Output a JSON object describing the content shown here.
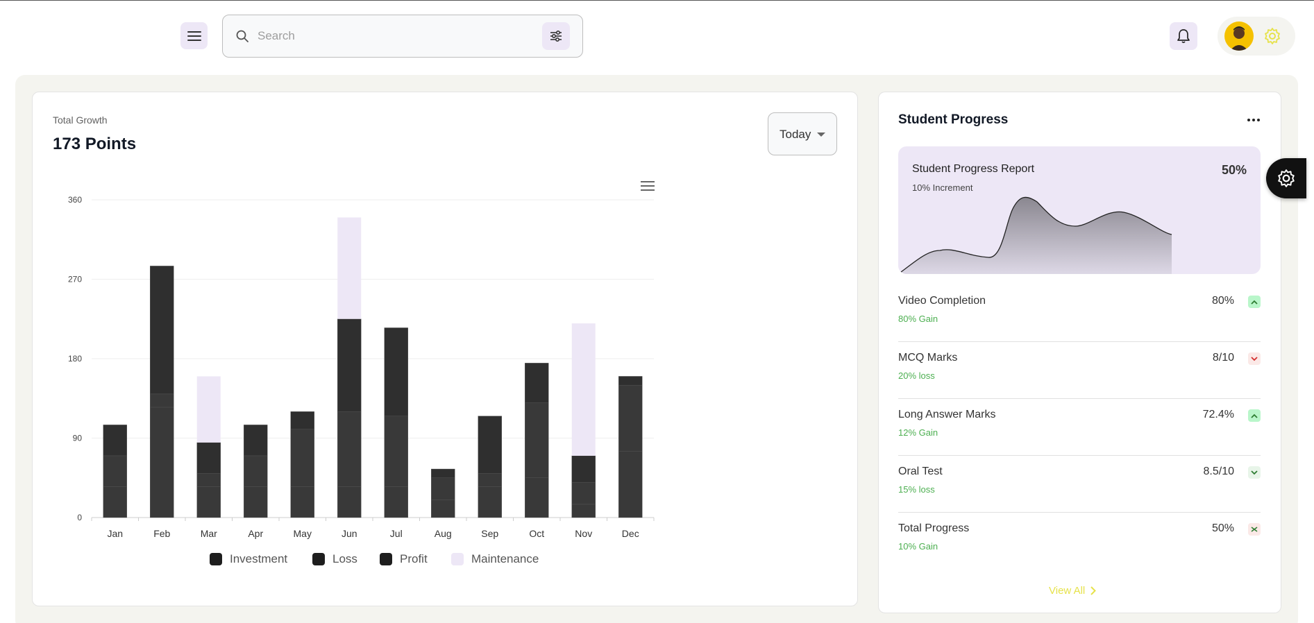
{
  "header": {
    "search_placeholder": "Search"
  },
  "growth": {
    "subtitle": "Total Growth",
    "title": "173 Points",
    "period_select": "Today"
  },
  "chart_data": {
    "type": "bar",
    "stacked": true,
    "categories": [
      "Jan",
      "Feb",
      "Mar",
      "Apr",
      "May",
      "Jun",
      "Jul",
      "Aug",
      "Sep",
      "Oct",
      "Nov",
      "Dec"
    ],
    "series": [
      {
        "name": "Investment",
        "color": "#393939",
        "values": [
          35,
          125,
          35,
          35,
          35,
          35,
          35,
          20,
          35,
          45,
          15,
          75
        ]
      },
      {
        "name": "Loss",
        "color": "#393939",
        "values": [
          35,
          15,
          15,
          35,
          65,
          85,
          80,
          25,
          15,
          85,
          25,
          75
        ]
      },
      {
        "name": "Profit",
        "color": "#2f2f2f",
        "values": [
          35,
          145,
          35,
          35,
          20,
          105,
          100,
          10,
          65,
          45,
          30,
          10
        ]
      },
      {
        "name": "Maintenance",
        "color": "#ede7f6",
        "values": [
          0,
          0,
          75,
          0,
          0,
          115,
          0,
          0,
          0,
          0,
          150,
          0
        ]
      }
    ],
    "yticks": [
      0,
      90,
      180,
      270,
      360
    ],
    "ylim": [
      0,
      360
    ],
    "grid": true,
    "legend_position": "bottom"
  },
  "student_progress": {
    "title": "Student Progress",
    "report": {
      "title": "Student Progress Report",
      "subtitle": "10% Increment",
      "percent": "50%"
    },
    "items": [
      {
        "label": "Video Completion",
        "value": "80%",
        "change": "80% Gain",
        "trend": "up"
      },
      {
        "label": "MCQ Marks",
        "value": "8/10",
        "change": "20% loss",
        "trend": "down"
      },
      {
        "label": "Long Answer Marks",
        "value": "72.4%",
        "change": "12% Gain",
        "trend": "up"
      },
      {
        "label": "Oral Test",
        "value": "8.5/10",
        "change": "15% loss",
        "trend": "down-green"
      },
      {
        "label": "Total Progress",
        "value": "50%",
        "change": "10% Gain",
        "trend": "mixed"
      }
    ],
    "view_all": "View All"
  },
  "icons": {
    "menu": "hamburger-icon",
    "search": "search-icon",
    "filter": "sliders-icon",
    "bell": "bell-icon",
    "gear": "gear-icon",
    "more": "more-horizontal-icon"
  },
  "colors": {
    "accent_purple": "#ede7f6",
    "accent_yellow": "#e6e24a",
    "gain_green": "#4caf50"
  }
}
